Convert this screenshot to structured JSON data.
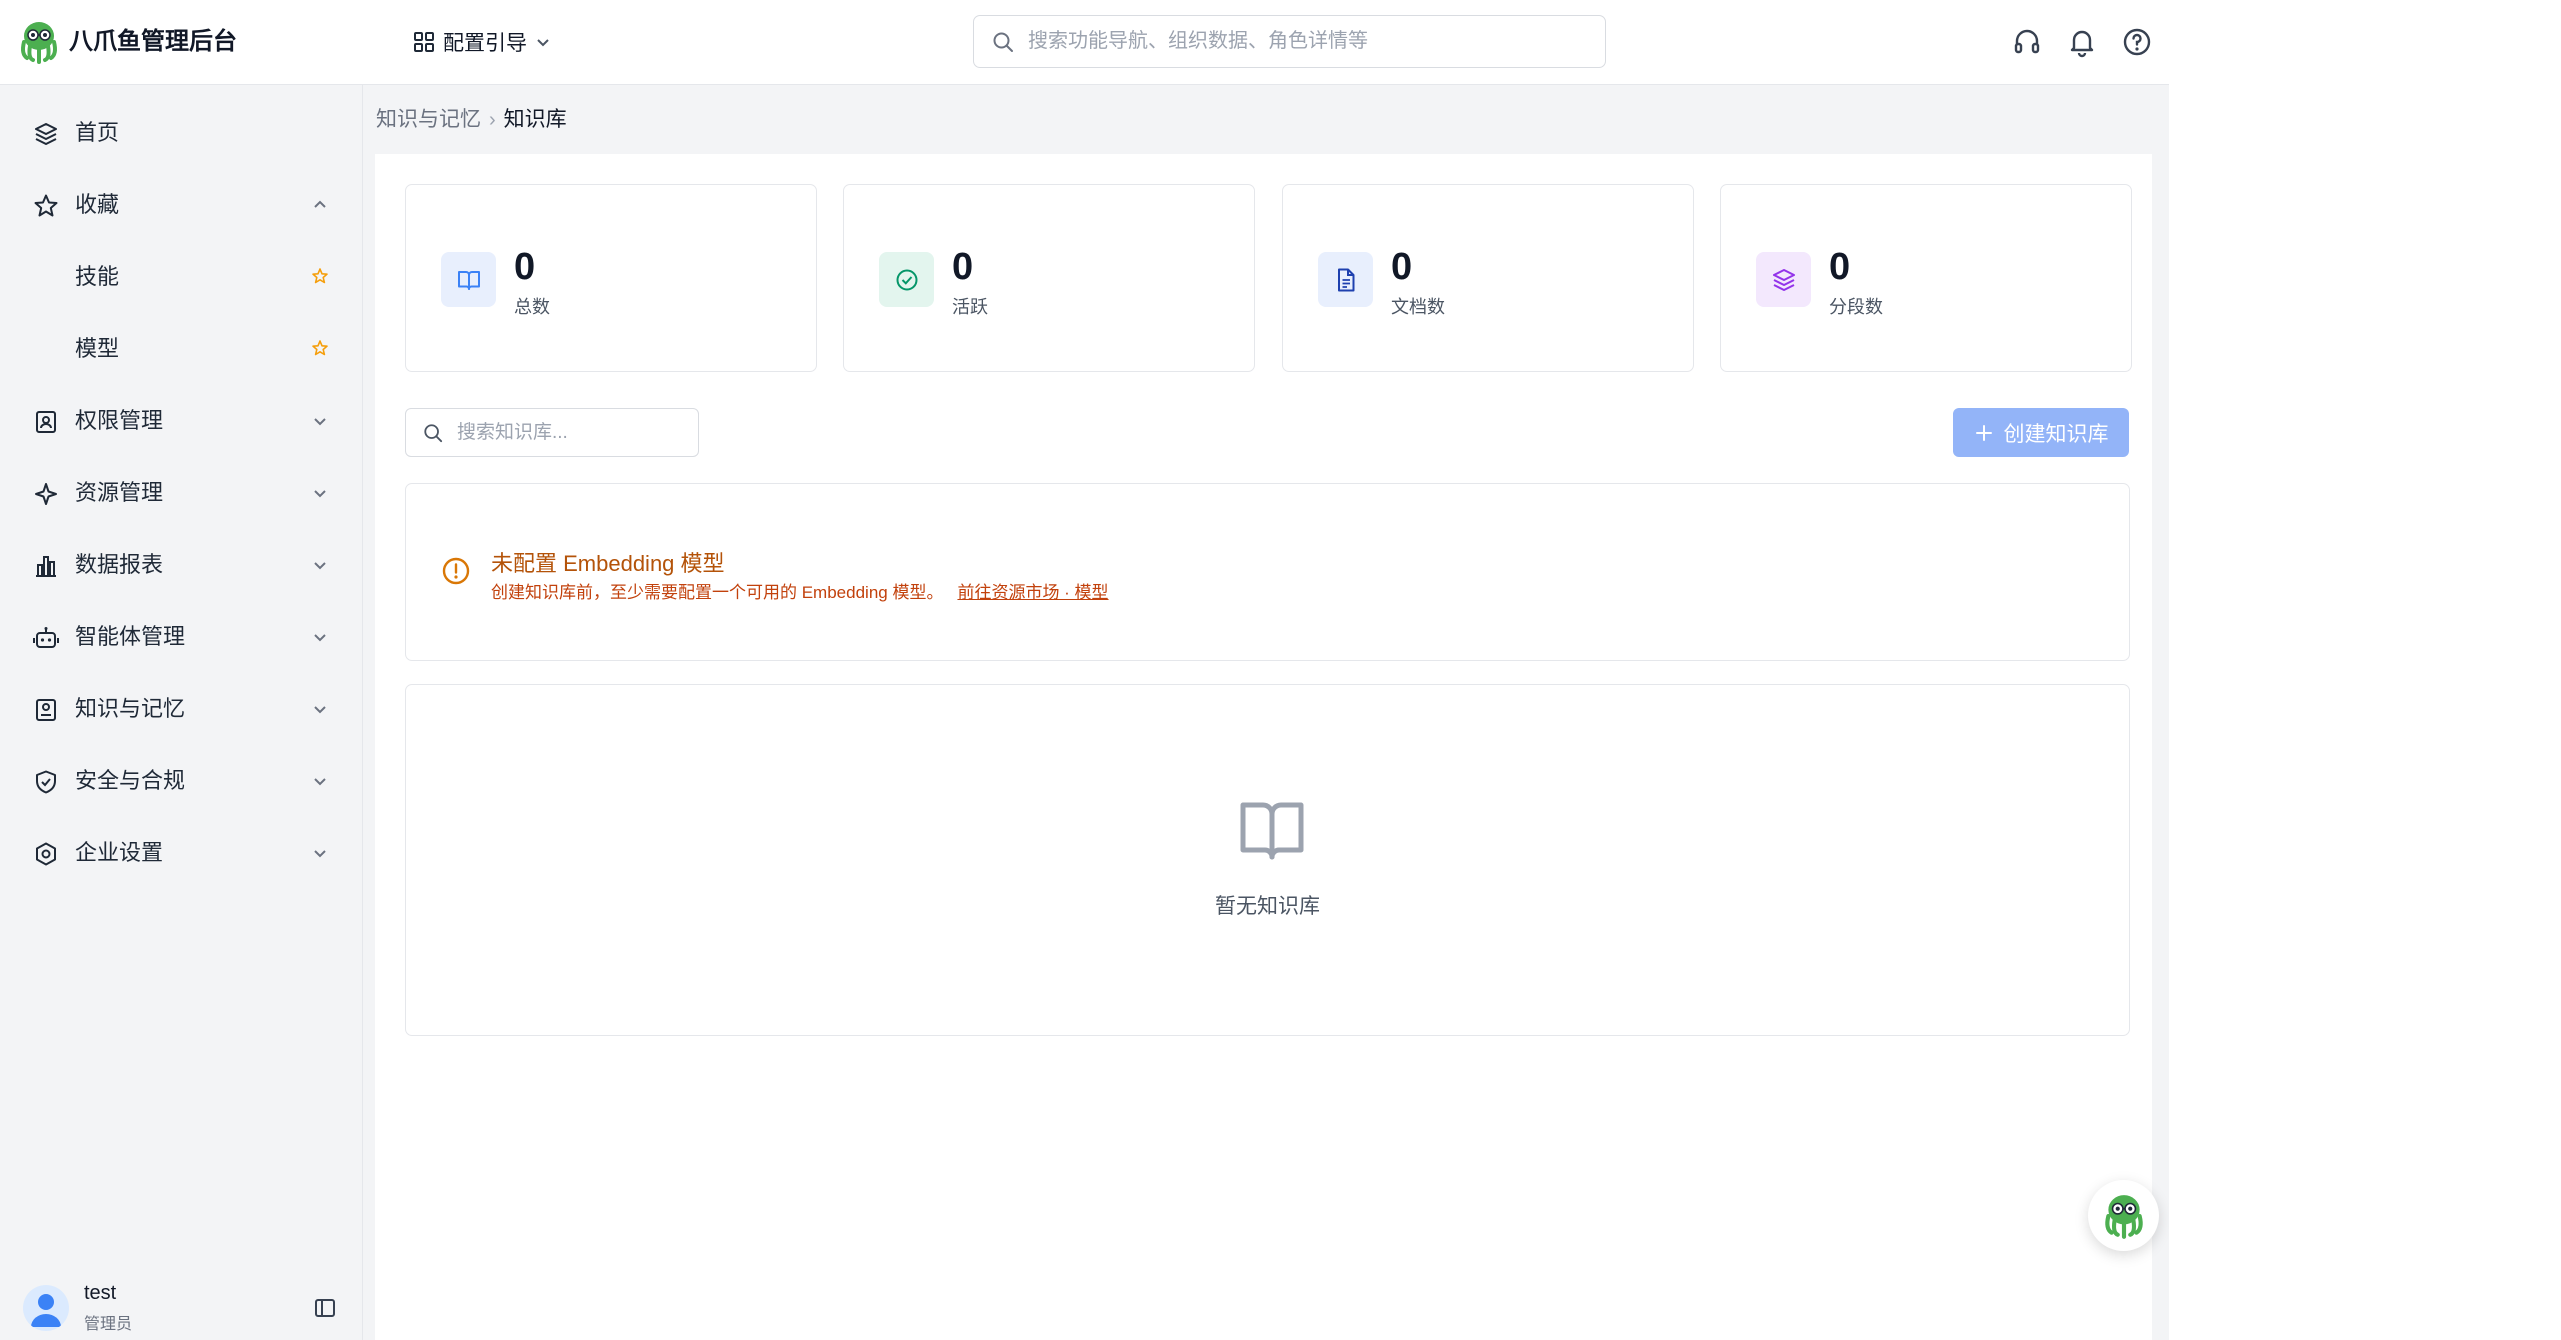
{
  "header": {
    "app_title": "八爪鱼管理后台",
    "guide_label": "配置引导",
    "search_placeholder": "搜索功能导航、组织数据、角色详情等"
  },
  "sidebar": {
    "items": [
      {
        "label": "首页",
        "icon": "layers-icon"
      },
      {
        "label": "收藏",
        "icon": "star-icon",
        "expanded": true
      },
      {
        "label": "技能",
        "favorite": true
      },
      {
        "label": "模型",
        "favorite": true
      },
      {
        "label": "权限管理",
        "icon": "id-badge-icon"
      },
      {
        "label": "资源管理",
        "icon": "sparkle-icon"
      },
      {
        "label": "数据报表",
        "icon": "bar-chart-icon"
      },
      {
        "label": "智能体管理",
        "icon": "robot-icon"
      },
      {
        "label": "知识与记忆",
        "icon": "knowledge-icon"
      },
      {
        "label": "安全与合规",
        "icon": "shield-icon"
      },
      {
        "label": "企业设置",
        "icon": "hexagon-settings-icon"
      }
    ],
    "user": {
      "name": "test",
      "role": "管理员"
    }
  },
  "breadcrumb": {
    "parent": "知识与记忆",
    "current": "知识库"
  },
  "stats": [
    {
      "value": "0",
      "label": "总数",
      "icon": "book-icon",
      "color": "#3b82f6",
      "bg": "#e8effd"
    },
    {
      "value": "0",
      "label": "活跃",
      "icon": "check-circle-icon",
      "color": "#059669",
      "bg": "#e3f5ee"
    },
    {
      "value": "0",
      "label": "文档数",
      "icon": "document-icon",
      "color": "#1e40af",
      "bg": "#e8effd"
    },
    {
      "value": "0",
      "label": "分段数",
      "icon": "layers-icon",
      "color": "#9333ea",
      "bg": "#f3e8fd"
    }
  ],
  "toolbar": {
    "search_placeholder": "搜索知识库...",
    "create_label": "创建知识库"
  },
  "alert": {
    "title": "未配置 Embedding 模型",
    "description": "创建知识库前，至少需要配置一个可用的 Embedding 模型。",
    "link": "前往资源市场 · 模型"
  },
  "empty_state": {
    "text": "暂无知识库"
  },
  "colors": {
    "primary_disabled": "#93b4f8",
    "warning": "#d97706",
    "star": "#f59e0b"
  }
}
